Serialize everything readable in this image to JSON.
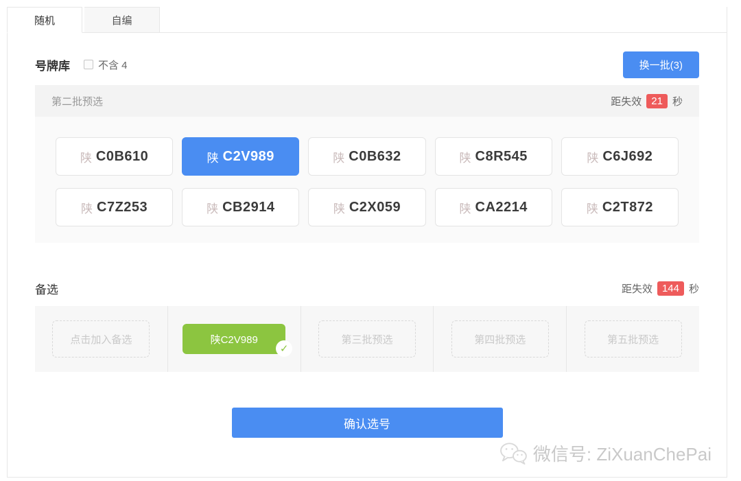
{
  "tabs": [
    {
      "label": "随机",
      "active": true
    },
    {
      "label": "自编",
      "active": false
    }
  ],
  "library": {
    "title": "号牌库",
    "filter_label": "不含 4",
    "filter_checked": false,
    "change_batch_label": "换一批(3)"
  },
  "batch": {
    "title": "第二批预选",
    "expiry_prefix": "距失效",
    "expiry_seconds": "21",
    "expiry_suffix": "秒",
    "plates": [
      {
        "prefix": "陕",
        "number": "C0B610",
        "selected": false
      },
      {
        "prefix": "陕",
        "number": "C2V989",
        "selected": true
      },
      {
        "prefix": "陕",
        "number": "C0B632",
        "selected": false
      },
      {
        "prefix": "陕",
        "number": "C8R545",
        "selected": false
      },
      {
        "prefix": "陕",
        "number": "C6J692",
        "selected": false
      },
      {
        "prefix": "陕",
        "number": "C7Z253",
        "selected": false
      },
      {
        "prefix": "陕",
        "number": "CB2914",
        "selected": false
      },
      {
        "prefix": "陕",
        "number": "C2X059",
        "selected": false
      },
      {
        "prefix": "陕",
        "number": "CA2214",
        "selected": false
      },
      {
        "prefix": "陕",
        "number": "C2T872",
        "selected": false
      }
    ]
  },
  "alternates": {
    "title": "备选",
    "expiry_prefix": "距失效",
    "expiry_seconds": "144",
    "expiry_suffix": "秒",
    "slots": [
      {
        "type": "empty",
        "label": "点击加入备选"
      },
      {
        "type": "filled",
        "label": "陕C2V989",
        "badge_icon": "check-icon"
      },
      {
        "type": "empty",
        "label": "第三批预选"
      },
      {
        "type": "empty",
        "label": "第四批预选"
      },
      {
        "type": "empty",
        "label": "第五批预选"
      }
    ]
  },
  "confirm_label": "确认选号",
  "watermark": {
    "icon": "wechat-icon",
    "text": "微信号: ZiXuanChePai"
  },
  "colors": {
    "accent_blue": "#4a8df2",
    "badge_red": "#ee5b5b",
    "selected_green": "#8cc540"
  }
}
